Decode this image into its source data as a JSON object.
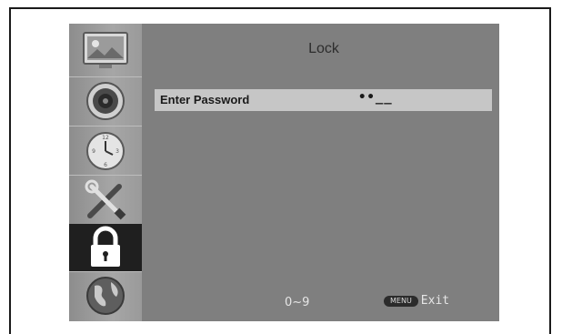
{
  "menu": {
    "title": "Lock",
    "sidebar": [
      {
        "icon": "picture-icon"
      },
      {
        "icon": "speaker-icon"
      },
      {
        "icon": "clock-icon"
      },
      {
        "icon": "tools-icon"
      },
      {
        "icon": "lock-icon",
        "active": true
      },
      {
        "icon": "globe-icon"
      }
    ],
    "password_row": {
      "label": "Enter Password",
      "value": "••__"
    }
  },
  "footer": {
    "hint": "0~9",
    "menu_key": "MENU",
    "exit_label": "Exit"
  }
}
